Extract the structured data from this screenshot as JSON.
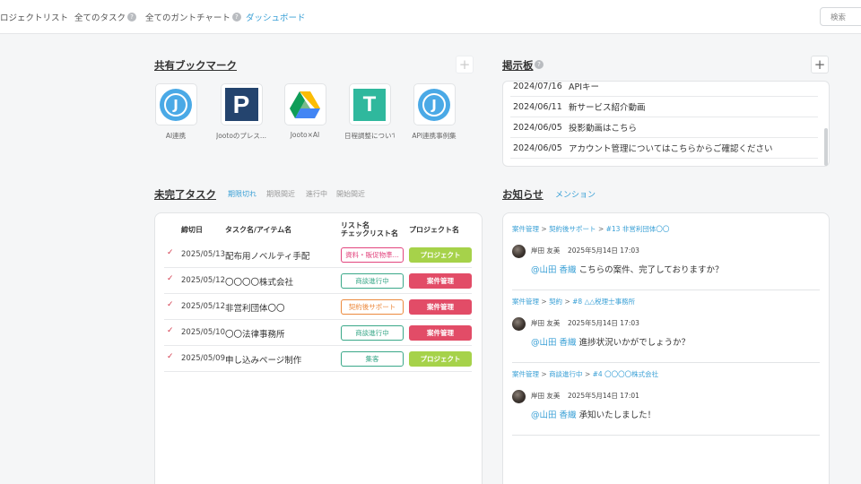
{
  "nav": {
    "items": [
      {
        "label": "ロジェクトリスト"
      },
      {
        "label": "全てのタスク"
      },
      {
        "label": "全てのガントチャート"
      },
      {
        "label": "ダッシュボード"
      }
    ],
    "search_label": "検索"
  },
  "bookmarks": {
    "title": "共有ブックマーク",
    "items": [
      {
        "label": "AI連携",
        "icon": "jooto-logo-icon"
      },
      {
        "label": "Jootoのプレス...",
        "icon": "p-logo-icon"
      },
      {
        "label": "Jooto×AI",
        "icon": "google-drive-icon"
      },
      {
        "label": "日程調整について",
        "icon": "t-logo-icon"
      },
      {
        "label": "API連携事例集",
        "icon": "jooto-logo-icon"
      }
    ]
  },
  "board": {
    "title": "掲示板",
    "rows": [
      {
        "date": "2024/07/16",
        "text": "APIキー"
      },
      {
        "date": "2024/06/11",
        "text": "新サービス紹介動画"
      },
      {
        "date": "2024/06/05",
        "text": "投影動画はこちら"
      },
      {
        "date": "2024/06/05",
        "text": "アカウント管理についてはこちらからご確認ください"
      }
    ]
  },
  "tasks": {
    "title": "未完了タスク",
    "tabs": [
      {
        "label": "期限切れ"
      },
      {
        "label": "期限間近"
      },
      {
        "label": "進行中"
      },
      {
        "label": "開始間近"
      }
    ],
    "headers": {
      "due": "締切日",
      "name": "タスク名/アイテム名",
      "list1": "リスト名",
      "list2": "チェックリスト名",
      "project": "プロジェクト名"
    },
    "rows": [
      {
        "date": "2025/05/13",
        "name": "配布用ノベルティ手配",
        "list": "資料・販促物準...",
        "project": "プロジェクト"
      },
      {
        "date": "2025/05/12",
        "name": "〇〇〇〇株式会社",
        "list": "商談進行中",
        "project": "案件管理"
      },
      {
        "date": "2025/05/12",
        "name": "非営利団体〇〇",
        "list": "契約後サポート",
        "project": "案件管理"
      },
      {
        "date": "2025/05/10",
        "name": "〇〇法律事務所",
        "list": "商談進行中",
        "project": "案件管理"
      },
      {
        "date": "2025/05/09",
        "name": "申し込みページ制作",
        "list": "集客",
        "project": "プロジェクト"
      }
    ]
  },
  "notices": {
    "title": "お知らせ",
    "tab": "メンション",
    "items": [
      {
        "crumb1": "案件管理",
        "crumb2": "契約後サポート",
        "crumb3": "#13 非営利団体〇〇",
        "author": "岸田 友美",
        "time": "2025年5月14日 17:03",
        "mention": "@山田 香織",
        "text": "こちらの案件、完了しておりますか？"
      },
      {
        "crumb1": "案件管理",
        "crumb2": "契約",
        "crumb3": "#8 △△税理士事務所",
        "author": "岸田 友美",
        "time": "2025年5月14日 17:03",
        "mention": "@山田 香織",
        "text": "進捗状況いかがでしょうか？"
      },
      {
        "crumb1": "案件管理",
        "crumb2": "商談進行中",
        "crumb3": "#4 〇〇〇〇株式会社",
        "author": "岸田 友美",
        "time": "2025年5月14日 17:01",
        "mention": "@山田 香織",
        "text": "承知いたしました！"
      }
    ]
  },
  "colors": {
    "accent": "#3aa0d6",
    "project_green": "#a6d24a",
    "project_red": "#e24c67",
    "check_red": "#d33a4c"
  }
}
